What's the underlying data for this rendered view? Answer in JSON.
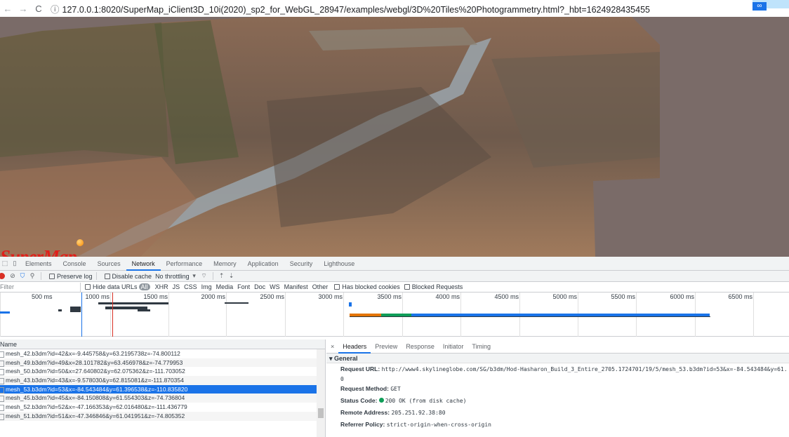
{
  "browser": {
    "url": "127.0.0.1:8020/SuperMap_iClient3D_10i(2020)_sp2_for_WebGL_28947/examples/webgl/3D%20Tiles%20Photogrammetry.html?_hbt=1624928435455"
  },
  "scene": {
    "logo_text": "SuperMap"
  },
  "devtools": {
    "tabs": [
      "Elements",
      "Console",
      "Sources",
      "Network",
      "Performance",
      "Memory",
      "Application",
      "Security",
      "Lighthouse"
    ],
    "active_tab": "Network",
    "toolbar": {
      "preserve_log": "Preserve log",
      "disable_cache": "Disable cache",
      "throttling": "No throttling"
    },
    "filter": {
      "placeholder": "Filter",
      "hide_data_urls": "Hide data URLs",
      "all": "All",
      "types": [
        "XHR",
        "JS",
        "CSS",
        "Img",
        "Media",
        "Font",
        "Doc",
        "WS",
        "Manifest",
        "Other"
      ],
      "has_blocked_cookies": "Has blocked cookies",
      "blocked_requests": "Blocked Requests"
    },
    "timeline_ticks": [
      "500 ms",
      "1000 ms",
      "1500 ms",
      "2000 ms",
      "2500 ms",
      "3000 ms",
      "3500 ms",
      "4000 ms",
      "4500 ms",
      "5000 ms",
      "5500 ms",
      "6000 ms",
      "6500 ms"
    ],
    "requests_header": "Name",
    "requests": [
      "mesh_42.b3dm?id=42&x=-9.445758&y=63.2195738z=-74.800112",
      "mesh_49.b3dm?id=49&x=28.101782&y=63.456978&z=-74.779953",
      "mesh_50.b3dm?id=50&x=27.640802&y=62.075362&z=-111.703052",
      "mesh_43.b3dm?id=43&x=-9.578030&y=62.815081&z=-111.870354",
      "mesh_53.b3dm?id=53&x=-84.543484&y=61.396538&z=-110.835820",
      "mesh_45.b3dm?id=45&x=-84.150808&y=61.554303&z=-74.736804",
      "mesh_52.b3dm?id=52&x=-47.166353&y=62.016480&z=-111.436779",
      "mesh_51.b3dm?id=51&x=-47.346846&y=61.041951&z=-74.805352"
    ],
    "selected_index": 4,
    "detail_tabs": [
      "Headers",
      "Preview",
      "Response",
      "Initiator",
      "Timing"
    ],
    "detail_active": "Headers",
    "general": {
      "section": "General",
      "request_url_label": "Request URL:",
      "request_url": "http://www4.skylineglobe.com/SG/b3dm/Hod-Hasharon_Build_3_Entire_2705.1724701/19/5/mesh_53.b3dm?id=53&x=-84.543484&y=61.",
      "request_url_cont": "0",
      "method_label": "Request Method:",
      "method": "GET",
      "status_label": "Status Code:",
      "status": "200 OK (from disk cache)",
      "remote_label": "Remote Address:",
      "remote": "205.251.92.38:80",
      "referrer_label": "Referrer Policy:",
      "referrer": "strict-origin-when-cross-origin"
    }
  }
}
